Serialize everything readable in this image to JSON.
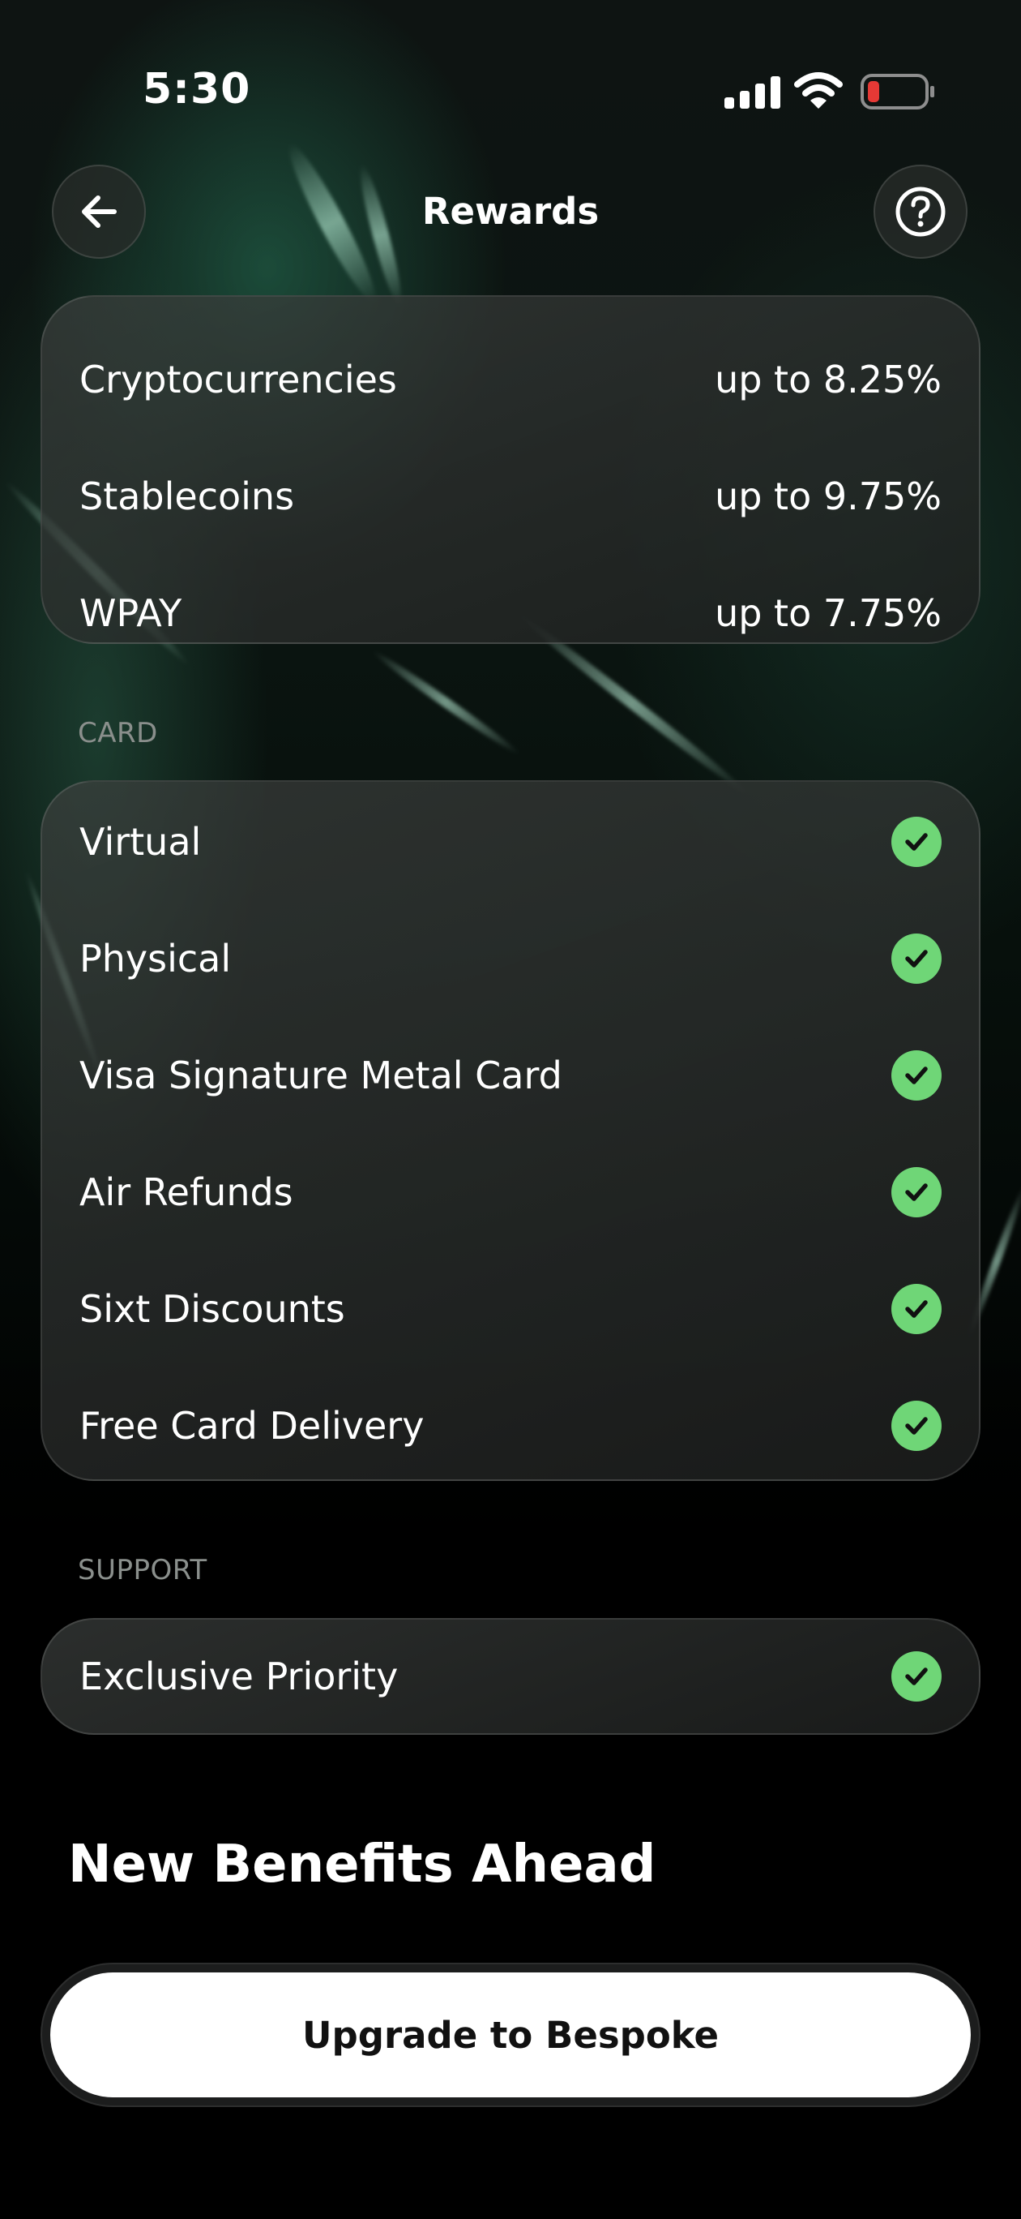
{
  "status_bar": {
    "time": "5:30"
  },
  "header": {
    "title": "Rewards"
  },
  "rates": [
    {
      "label": "Cryptocurrencies",
      "value": "up to 8.25%"
    },
    {
      "label": "Stablecoins",
      "value": "up to 9.75%"
    },
    {
      "label": "WPAY",
      "value": "up to 7.75%"
    }
  ],
  "card_section": {
    "label": "CARD",
    "items": [
      {
        "label": "Virtual"
      },
      {
        "label": "Physical"
      },
      {
        "label": "Visa Signature Metal Card"
      },
      {
        "label": "Air Refunds"
      },
      {
        "label": "Sixt Discounts"
      },
      {
        "label": "Free Card Delivery"
      }
    ]
  },
  "support_section": {
    "label": "SUPPORT",
    "items": [
      {
        "label": "Exclusive Priority"
      }
    ]
  },
  "benefits": {
    "title": "New Benefits Ahead"
  },
  "upgrade": {
    "label": "Upgrade to Bespoke"
  },
  "colors": {
    "check": "#6fd677",
    "battery_low": "#e53935",
    "background": "#000000"
  }
}
